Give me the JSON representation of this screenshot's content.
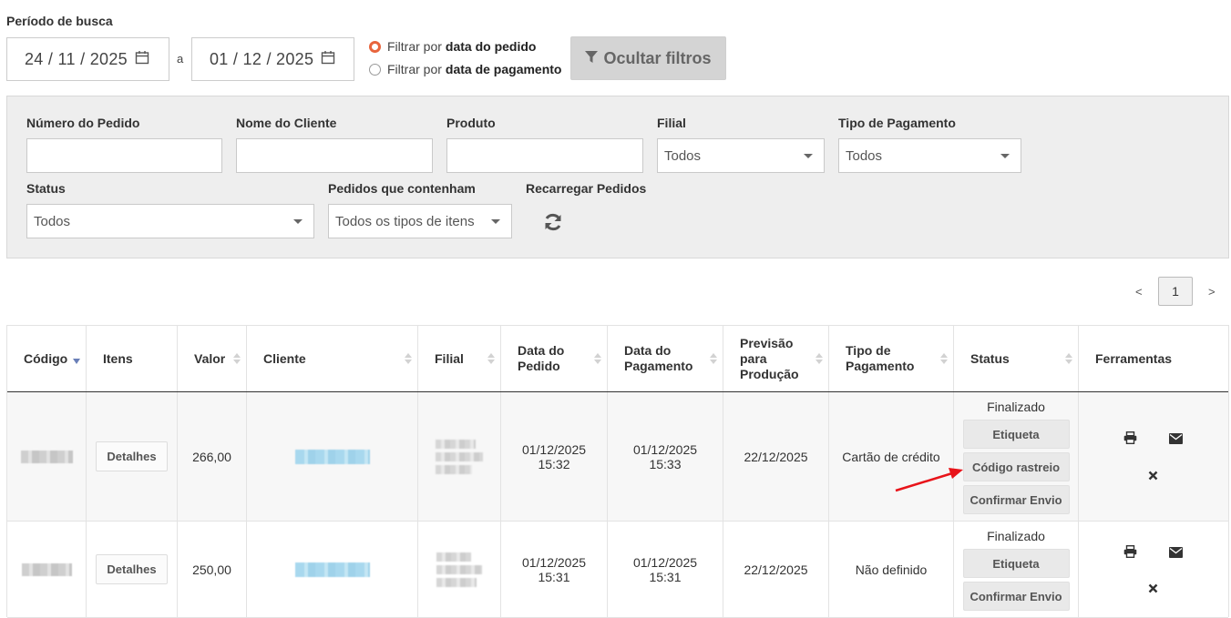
{
  "period": {
    "label": "Período de busca",
    "date_from": "24 / 11 / 2025",
    "date_to": "01 / 12 / 2025",
    "separator": "a",
    "radio_order_prefix": "Filtrar por",
    "radio_order_bold": "data do pedido",
    "radio_order_checked": true,
    "radio_payment_prefix": "Filtrar por",
    "radio_payment_bold": "data de pagamento",
    "radio_payment_checked": false,
    "hide_filters_label": "Ocultar filtros"
  },
  "filters": {
    "order_number_label": "Número do Pedido",
    "order_number_value": "",
    "client_name_label": "Nome do Cliente",
    "client_name_value": "",
    "product_label": "Produto",
    "product_value": "",
    "branch_label": "Filial",
    "branch_value": "Todos",
    "payment_type_label": "Tipo de Pagamento",
    "payment_type_value": "Todos",
    "status_label": "Status",
    "status_value": "Todos",
    "contains_label": "Pedidos que contenham",
    "contains_value": "Todos os tipos de itens",
    "reload_label": "Recarregar Pedidos"
  },
  "pagination": {
    "prev": "<",
    "current": "1",
    "next": ">"
  },
  "table": {
    "headers": {
      "code": "Código",
      "items": "Itens",
      "value": "Valor",
      "client": "Cliente",
      "branch": "Filial",
      "order_date_1": "Data do",
      "order_date_2": "Pedido",
      "payment_date_1": "Data do",
      "payment_date_2": "Pagamento",
      "forecast_1": "Previsão",
      "forecast_2": "para",
      "forecast_3": "Produção",
      "payment_type_1": "Tipo de",
      "payment_type_2": "Pagamento",
      "status": "Status",
      "tools": "Ferramentas"
    },
    "rows": [
      {
        "details_label": "Detalhes",
        "value": "266,00",
        "order_date": "01/12/2025",
        "order_time": "15:32",
        "payment_date": "01/12/2025",
        "payment_time": "15:33",
        "forecast": "22/12/2025",
        "payment_type": "Cartão de crédito",
        "status": "Finalizado",
        "btn_label": "Etiqueta",
        "btn_tracking": "Código rastreio",
        "btn_confirm": "Confirmar Envio"
      },
      {
        "details_label": "Detalhes",
        "value": "250,00",
        "order_date": "01/12/2025",
        "order_time": "15:31",
        "payment_date": "01/12/2025",
        "payment_time": "15:31",
        "forecast": "22/12/2025",
        "payment_type": "Não definido",
        "status": "Finalizado",
        "btn_label": "Etiqueta",
        "btn_confirm": "Confirmar Envio"
      }
    ]
  },
  "icons": {
    "calendar": "calendar-icon",
    "filter": "filter-icon",
    "reload": "refresh-icon",
    "print": "print-icon",
    "email": "envelope-icon",
    "delete": "close-icon",
    "annotation": "red-arrow"
  },
  "colors": {
    "radio_accent": "#e8643c",
    "annotation_arrow": "#e8141a",
    "sort_active": "#6a7fb8"
  }
}
